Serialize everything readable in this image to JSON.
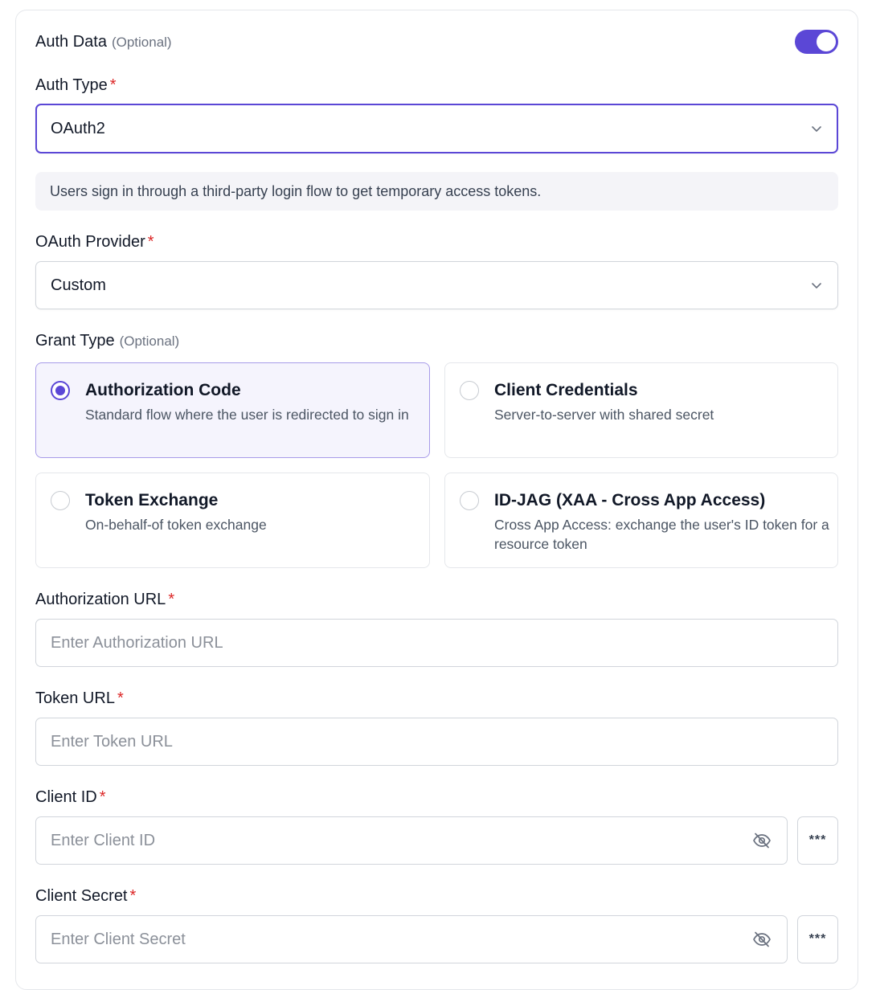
{
  "auth_data": {
    "title": "Auth Data",
    "optional": "(Optional)",
    "enabled": true
  },
  "auth_type": {
    "label": "Auth Type",
    "required_mark": "*",
    "value": "OAuth2"
  },
  "info_text": "Users sign in through a third-party login flow to get temporary access tokens.",
  "oauth_provider": {
    "label": "OAuth Provider",
    "required_mark": "*",
    "value": "Custom"
  },
  "grant_type": {
    "label": "Grant Type",
    "optional": "(Optional)",
    "options": [
      {
        "title": "Authorization Code",
        "description": "Standard flow where the user is redirected to sign in",
        "selected": true
      },
      {
        "title": "Client Credentials",
        "description": "Server-to-server with shared secret",
        "selected": false
      },
      {
        "title": "Token Exchange",
        "description": "On-behalf-of token exchange",
        "selected": false
      },
      {
        "title": "ID-JAG (XAA - Cross App Access)",
        "description": "Cross App Access: exchange the user's ID token for a resource token",
        "selected": false
      }
    ]
  },
  "fields": {
    "authorization_url": {
      "label": "Authorization URL",
      "required_mark": "*",
      "placeholder": "Enter Authorization URL"
    },
    "token_url": {
      "label": "Token URL",
      "required_mark": "*",
      "placeholder": "Enter Token URL"
    },
    "client_id": {
      "label": "Client ID",
      "required_mark": "*",
      "placeholder": "Enter Client ID",
      "dots": "***"
    },
    "client_secret": {
      "label": "Client Secret",
      "required_mark": "*",
      "placeholder": "Enter Client Secret",
      "dots": "***"
    }
  },
  "colors": {
    "accent": "#5b47d6",
    "required": "#dc2626",
    "info_bg": "#f4f4f8"
  },
  "icons": {
    "select_caret": "chevron-down-icon",
    "visibility": "eye-off-icon"
  }
}
